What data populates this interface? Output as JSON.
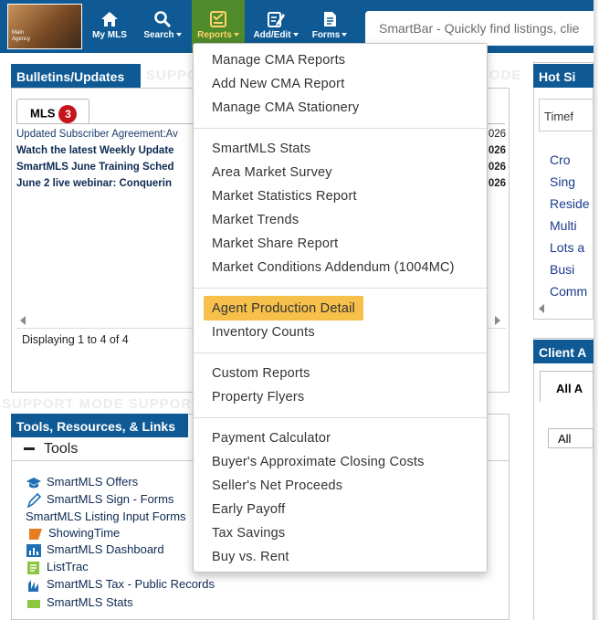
{
  "topbar": {
    "logo_text": "Main Agency",
    "nav": [
      {
        "label": "My MLS",
        "icon": "home-icon",
        "caret": false
      },
      {
        "label": "Search",
        "icon": "search-icon",
        "caret": true
      },
      {
        "label": "Reports",
        "icon": "report-icon",
        "caret": true
      },
      {
        "label": "Add/Edit",
        "icon": "edit-icon",
        "caret": true
      },
      {
        "label": "Forms",
        "icon": "document-icon",
        "caret": true
      }
    ],
    "smartbar_placeholder": "SmartBar - Quickly find listings, clie"
  },
  "watermark": "SUPPORT MODE SUPPORT MODE SUPPORT MODE",
  "bulletins": {
    "title": "Bulletins/Updates",
    "tab_label": "MLS",
    "tab_count": "3",
    "items": [
      {
        "text": "Updated Subscriber Agreement:Av",
        "date": "026"
      },
      {
        "text": "Watch the latest Weekly Update",
        "date": "026"
      },
      {
        "text": "SmartMLS June Training Sched",
        "date": "026"
      },
      {
        "text": "June 2 live webinar: Conquerin",
        "date": "026"
      }
    ],
    "footer": "Displaying 1 to 4 of 4"
  },
  "tools": {
    "title": "Tools, Resources, & Links",
    "section": "Tools",
    "items": [
      {
        "label": "SmartMLS Offers",
        "icon": "graduation-cap-icon"
      },
      {
        "label": "SmartMLS Sign - Forms",
        "icon": "pen-icon"
      },
      {
        "label": "SmartMLS Listing Input Forms",
        "icon": ""
      },
      {
        "label": "ShowingTime",
        "icon": "showingtime-logo-icon"
      },
      {
        "label": "SmartMLS Dashboard",
        "icon": "dashboard-icon"
      },
      {
        "label": "ListTrac",
        "icon": "listtrac-icon"
      },
      {
        "label": "SmartMLS Tax - Public Records",
        "icon": "tax-records-icon"
      },
      {
        "label": "SmartMLS Stats",
        "icon": "stats-icon"
      }
    ]
  },
  "hot_sheets": {
    "title": "Hot Si",
    "filter": "Timef",
    "items": [
      "Cro",
      "Sing",
      "Reside",
      "Multi",
      "Lots a",
      "Busi",
      "Comm"
    ]
  },
  "client": {
    "title": "Client A",
    "tab": "All A",
    "select": "All"
  },
  "reports_menu": {
    "groups": [
      [
        "Manage CMA Reports",
        "Add New CMA Report",
        "Manage CMA Stationery"
      ],
      [
        "SmartMLS Stats",
        "Area Market Survey",
        "Market Statistics Report",
        "Market Trends",
        "Market Share Report",
        "Market Conditions Addendum (1004MC)"
      ],
      [
        "Agent Production Detail",
        "Inventory Counts"
      ],
      [
        "Custom Reports",
        "Property Flyers"
      ],
      [
        "Payment Calculator",
        "Buyer's Approximate Closing Costs",
        "Seller's Net Proceeds",
        "Early Payoff",
        "Tax Savings",
        "Buy vs. Rent"
      ]
    ],
    "highlighted": "Agent Production Detail",
    "highlight_color": "#f6c04b"
  },
  "colors": {
    "brand_blue": "#0f5a95",
    "active_nav": "#4f8a2b",
    "badge_red": "#c7141b",
    "link_navy": "#0d2a52"
  }
}
